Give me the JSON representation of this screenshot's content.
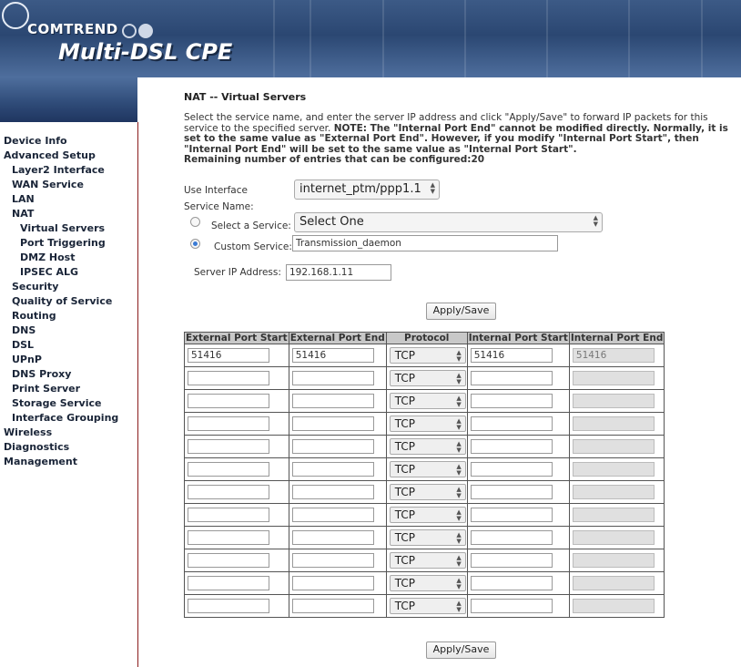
{
  "brand": {
    "company": "COMTREND",
    "product": "Multi-DSL CPE"
  },
  "nav": [
    {
      "label": "Device Info",
      "level": 0
    },
    {
      "label": "Advanced Setup",
      "level": 0
    },
    {
      "label": "Layer2 Interface",
      "level": 1
    },
    {
      "label": "WAN Service",
      "level": 1
    },
    {
      "label": "LAN",
      "level": 1
    },
    {
      "label": "NAT",
      "level": 1
    },
    {
      "label": "Virtual Servers",
      "level": 2
    },
    {
      "label": "Port Triggering",
      "level": 2
    },
    {
      "label": "DMZ Host",
      "level": 2
    },
    {
      "label": "IPSEC ALG",
      "level": 2
    },
    {
      "label": "Security",
      "level": 1
    },
    {
      "label": "Quality of Service",
      "level": 1
    },
    {
      "label": "Routing",
      "level": 1
    },
    {
      "label": "DNS",
      "level": 1
    },
    {
      "label": "DSL",
      "level": 1
    },
    {
      "label": "UPnP",
      "level": 1
    },
    {
      "label": "DNS Proxy",
      "level": 1
    },
    {
      "label": "Print Server",
      "level": 1
    },
    {
      "label": "Storage Service",
      "level": 1
    },
    {
      "label": "Interface Grouping",
      "level": 1
    },
    {
      "label": "Wireless",
      "level": 0
    },
    {
      "label": "Diagnostics",
      "level": 0
    },
    {
      "label": "Management",
      "level": 0
    }
  ],
  "page": {
    "title": "NAT -- Virtual Servers",
    "desc_1": "Select the service name, and enter the server IP address and click \"Apply/Save\" to forward IP packets for this service to the specified server. ",
    "desc_note": "NOTE: The \"Internal Port End\" cannot be modified directly. Normally, it is set to the same value as \"External Port End\". However, if you modify \"Internal Port Start\", then \"Internal Port End\" will be set to the same value as \"Internal Port Start\".",
    "remaining": "Remaining number of entries that can be configured:20"
  },
  "form": {
    "use_interface_label": "Use Interface",
    "use_interface_value": "internet_ptm/ppp1.1",
    "service_name_label": "Service Name:",
    "select_service_label": "Select a Service:",
    "select_service_value": "Select One",
    "custom_service_label": "Custom Service:",
    "custom_service_value": "Transmission_daemon",
    "server_ip_label": "Server IP Address:",
    "server_ip_value": "192.168.1.11",
    "apply_label": "Apply/Save"
  },
  "table": {
    "headers": [
      "External Port Start",
      "External Port End",
      "Protocol",
      "Internal Port Start",
      "Internal Port End"
    ],
    "rows": [
      {
        "ext_start": "51416",
        "ext_end": "51416",
        "protocol": "TCP",
        "int_start": "51416",
        "int_end": "51416"
      },
      {
        "ext_start": "",
        "ext_end": "",
        "protocol": "TCP",
        "int_start": "",
        "int_end": ""
      },
      {
        "ext_start": "",
        "ext_end": "",
        "protocol": "TCP",
        "int_start": "",
        "int_end": ""
      },
      {
        "ext_start": "",
        "ext_end": "",
        "protocol": "TCP",
        "int_start": "",
        "int_end": ""
      },
      {
        "ext_start": "",
        "ext_end": "",
        "protocol": "TCP",
        "int_start": "",
        "int_end": ""
      },
      {
        "ext_start": "",
        "ext_end": "",
        "protocol": "TCP",
        "int_start": "",
        "int_end": ""
      },
      {
        "ext_start": "",
        "ext_end": "",
        "protocol": "TCP",
        "int_start": "",
        "int_end": ""
      },
      {
        "ext_start": "",
        "ext_end": "",
        "protocol": "TCP",
        "int_start": "",
        "int_end": ""
      },
      {
        "ext_start": "",
        "ext_end": "",
        "protocol": "TCP",
        "int_start": "",
        "int_end": ""
      },
      {
        "ext_start": "",
        "ext_end": "",
        "protocol": "TCP",
        "int_start": "",
        "int_end": ""
      },
      {
        "ext_start": "",
        "ext_end": "",
        "protocol": "TCP",
        "int_start": "",
        "int_end": ""
      },
      {
        "ext_start": "",
        "ext_end": "",
        "protocol": "TCP",
        "int_start": "",
        "int_end": ""
      }
    ]
  }
}
